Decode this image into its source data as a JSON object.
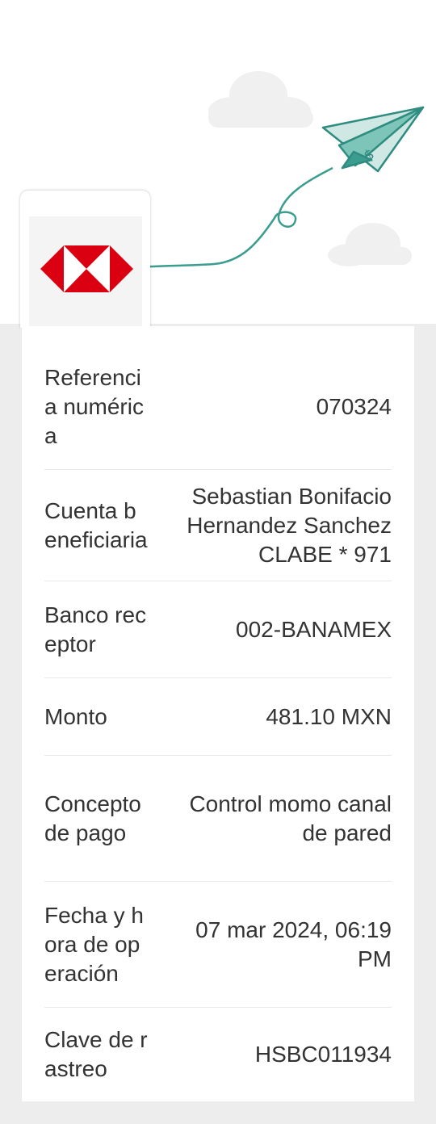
{
  "bank": {
    "name": "HSBC",
    "logo_colors": {
      "red": "#db0011",
      "white": "#ffffff"
    }
  },
  "theme": {
    "accent": "#3a9d8f",
    "background": "#ededed",
    "text": "#333333"
  },
  "details": [
    {
      "label": "Referencia numérica",
      "value": [
        "070324"
      ]
    },
    {
      "label": "Cuenta beneficiaria",
      "value": [
        "Sebastian Bonifacio",
        "Hernandez Sanchez",
        "CLABE * 971"
      ]
    },
    {
      "label": "Banco receptor",
      "value": [
        "002-BANAMEX"
      ]
    },
    {
      "label": "Monto",
      "value": [
        "481.10 MXN"
      ]
    },
    {
      "label": "Concepto de pago",
      "value": [
        "Control momo canal",
        "de pared"
      ]
    },
    {
      "label": "Fecha y hora de operación",
      "value": [
        "07 mar 2024, 06:19",
        "PM"
      ]
    },
    {
      "label": "Clave de rastreo",
      "value": [
        "HSBC011934"
      ]
    }
  ]
}
